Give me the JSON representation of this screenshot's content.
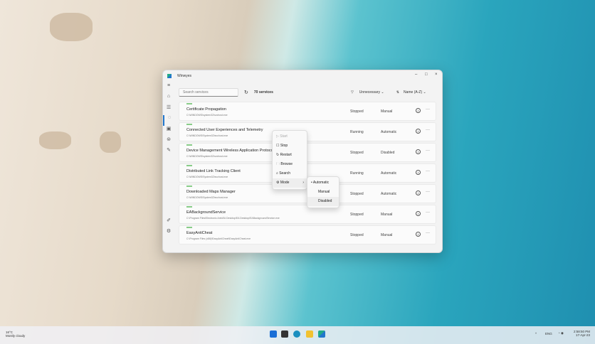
{
  "window": {
    "title": "Winwyes"
  },
  "toolbar": {
    "search_placeholder": "Search services",
    "count": "70 services",
    "filter": "Unnecessary",
    "sort": "Name (A-Z)"
  },
  "services": [
    {
      "name": "Certificate Propagation",
      "path": "C:\\WINDOWS\\system32\\svchost.exe",
      "status": "Stopped",
      "mode": "Manual"
    },
    {
      "name": "Connected User Experiences and Telemetry",
      "path": "C:\\WINDOWS\\System32\\svchost.exe",
      "status": "Running",
      "mode": "Automatic"
    },
    {
      "name": "Device Management Wireless Application Protocol",
      "path": "C:\\WINDOWS\\system32\\svchost.exe",
      "status": "Stopped",
      "mode": "Disabled"
    },
    {
      "name": "Distributed Link Tracking Client",
      "path": "C:\\WINDOWS\\System32\\svchost.exe",
      "status": "Running",
      "mode": "Automatic"
    },
    {
      "name": "Downloaded Maps Manager",
      "path": "C:\\WINDOWS\\System32\\svchost.exe",
      "status": "Stopped",
      "mode": "Automatic"
    },
    {
      "name": "EABackgroundService",
      "path": "C:\\Program Files\\Electronic Arts\\EA Desktop\\EA Desktop\\EABackgroundService.exe",
      "status": "Stopped",
      "mode": "Manual"
    },
    {
      "name": "EasyAntiCheat",
      "path": "C:\\Program Files (x86)\\EasyAntiCheat\\EasyAntiCheat.exe",
      "status": "Stopped",
      "mode": "Manual"
    }
  ],
  "context_menu": [
    "Start",
    "Stop",
    "Restart",
    "Browse",
    "Search",
    "Mode"
  ],
  "submenu": [
    "Automatic",
    "Manual",
    "Disabled"
  ],
  "taskbar": {
    "temp": "16°C",
    "weather": "Mostly cloudy",
    "lang": "ENG",
    "time": "2:58:50 PM",
    "date": "17-Apr-23"
  }
}
